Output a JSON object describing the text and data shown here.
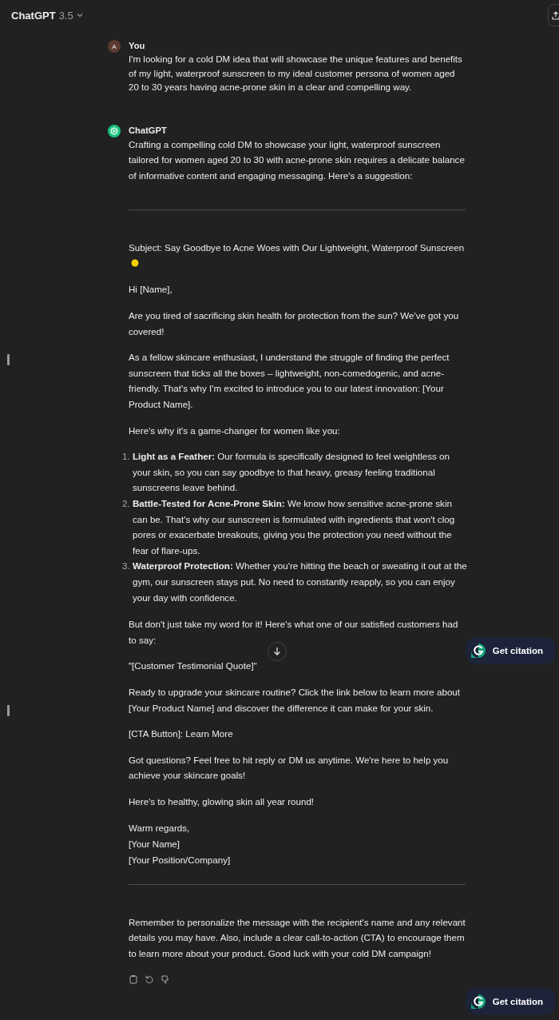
{
  "header": {
    "model": "ChatGPT",
    "version": "3.5"
  },
  "messages": [
    {
      "kind": "user",
      "author": "You",
      "avatar": "A",
      "blocks": [
        {
          "kind": "paragraph",
          "text": "I'm looking for a cold DM idea that will showcase the unique features and benefits of my light, waterproof sunscreen to my ideal customer persona of women aged 20 to 30 years having acne-prone skin in a clear and compelling way."
        }
      ]
    },
    {
      "kind": "assistant",
      "author": "ChatGPT",
      "blocks": [
        {
          "kind": "paragraph",
          "text": "Crafting a compelling cold DM to showcase your light, waterproof sunscreen tailored for women aged 20 to 30 with acne-prone skin requires a delicate balance of informative content and engaging messaging. Here's a suggestion:"
        },
        {
          "kind": "rule"
        },
        {
          "kind": "subject",
          "text": "Subject: Say Goodbye to Acne Woes with Our Lightweight, Waterproof Sunscreen"
        },
        {
          "kind": "paragraph",
          "text": "Hi [Name],"
        },
        {
          "kind": "paragraph",
          "text": "Are you tired of sacrificing skin health for protection from the sun? We've got you covered!"
        },
        {
          "kind": "paragraph",
          "text": "As a fellow skincare enthusiast, I understand the struggle of finding the perfect sunscreen that ticks all the boxes – lightweight, non-comedogenic, and acne-friendly. That's why I'm excited to introduce you to our latest innovation: [Your Product Name]."
        },
        {
          "kind": "paragraph",
          "text": "Here's why it's a game-changer for women like you:"
        },
        {
          "kind": "list",
          "items": [
            {
              "number": "1.",
              "text": "**Light as a Feather:** Our formula is specifically designed to feel weightless on your skin, so you can say goodbye to that heavy, greasy feeling traditional sunscreens leave behind."
            },
            {
              "number": "2.",
              "text": "**Battle-Tested for Acne-Prone Skin:** We know how sensitive acne-prone skin can be. That's why our sunscreen is formulated with ingredients that won't clog pores or exacerbate breakouts, giving you the protection you need without the fear of flare-ups."
            },
            {
              "number": "3.",
              "text": "**Waterproof Protection:** Whether you're hitting the beach or sweating it out at the gym, our sunscreen stays put. No need to constantly reapply, so you can enjoy your day with confidence."
            }
          ]
        },
        {
          "kind": "paragraph",
          "text": "But don't just take my word for it! Here's what one of our satisfied customers had to say:"
        },
        {
          "kind": "paragraph",
          "text": "\"[Customer Testimonial Quote]\""
        },
        {
          "kind": "paragraph",
          "text": "Ready to upgrade your skincare routine? Click the link below to learn more about [Your Product Name] and discover the difference it can make for your skin."
        },
        {
          "kind": "paragraph",
          "text": "[CTA Button]: Learn More"
        },
        {
          "kind": "paragraph",
          "text": "Got questions? Feel free to hit reply or DM us anytime. We're here to help you achieve your skincare goals!"
        },
        {
          "kind": "paragraph",
          "text": "Here's to healthy, glowing skin all year round!"
        },
        {
          "kind": "lines",
          "lines": [
            "Warm regards,",
            "[Your Name]",
            "[Your Position/Company]"
          ]
        },
        {
          "kind": "rule"
        },
        {
          "kind": "paragraph",
          "text": "Remember to personalize the message with the recipient's name and any relevant details you may have. Also, include a clear call-to-action (CTA) to encourage them to learn more about your product. Good luck with your cold DM campaign!"
        }
      ]
    }
  ],
  "citation_buttons": [
    "Get citation",
    "Get citation"
  ]
}
